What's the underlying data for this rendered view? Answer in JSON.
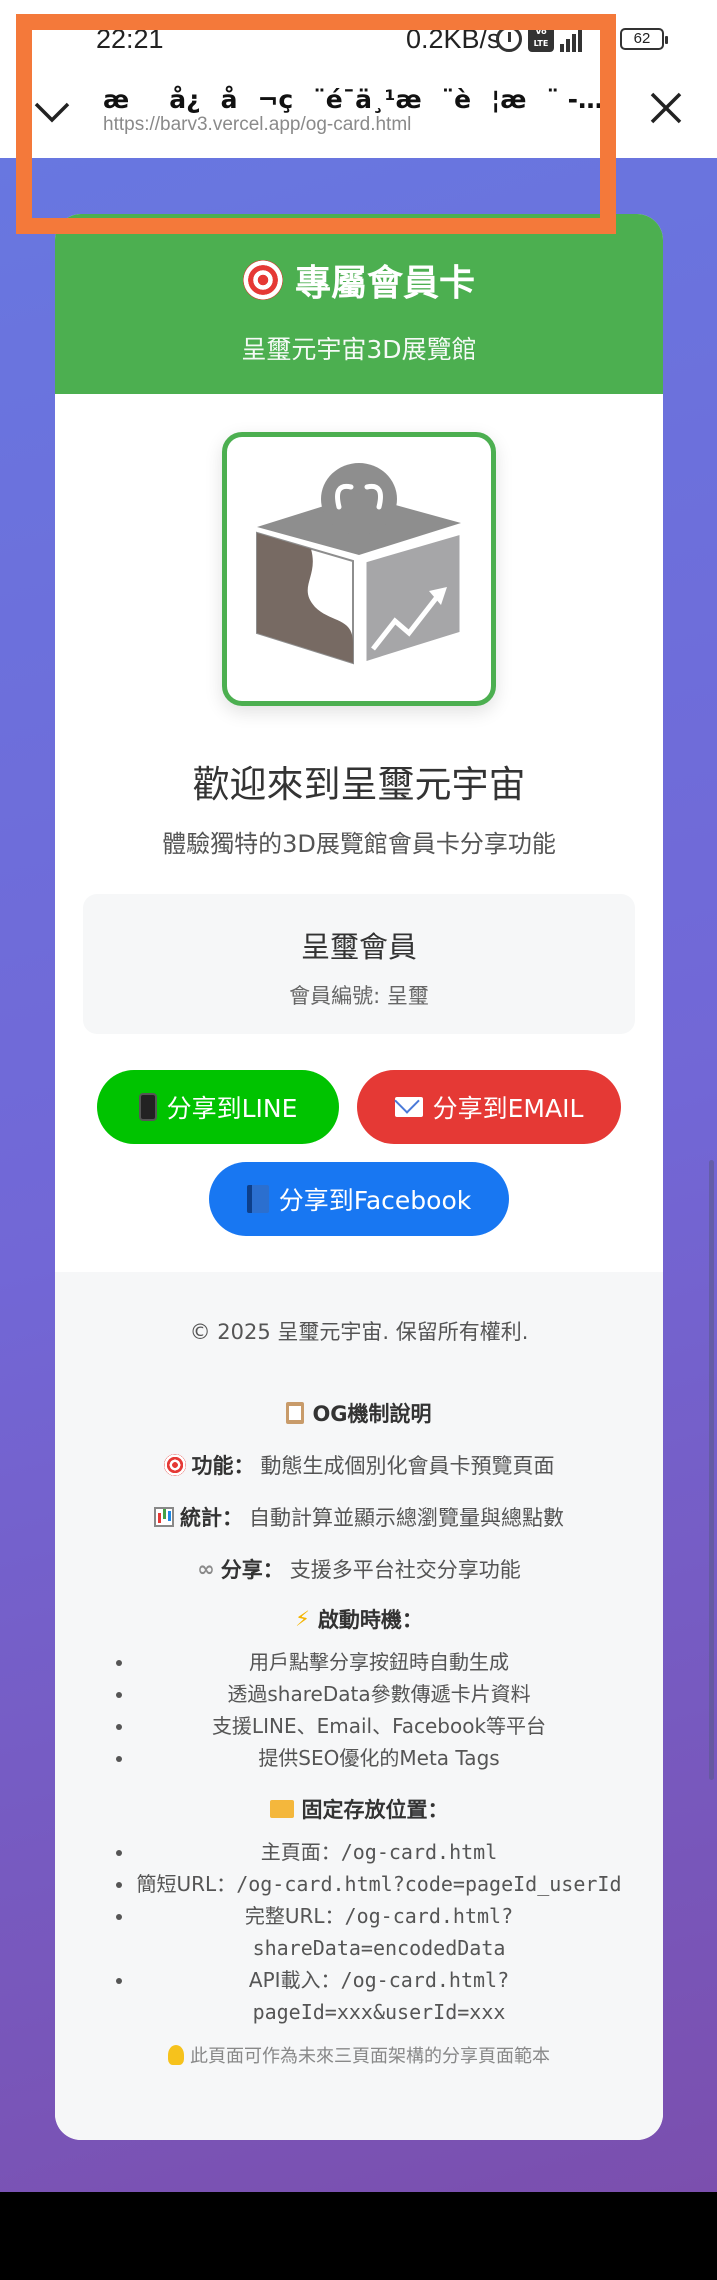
{
  "status_bar": {
    "time": "22:21",
    "network_speed": "0.2KB/s",
    "volte_label": "Vo LTE",
    "signal_label": "5G",
    "battery": "62"
  },
  "browser": {
    "page_title": "æå¿å¬ç¨é¯ä¸¹æ¨è¦æ¨ - 呈璽元...",
    "url": "https://barv3.vercel.app/og-card.html",
    "colors": {
      "highlight": "#f4793a"
    }
  },
  "card": {
    "header_title": "專屬會員卡",
    "header_subtitle": "呈璽元宇宙3D展覽館",
    "welcome": "歡迎來到呈璽元宇宙",
    "welcome_sub": "體驗獨特的3D展覽館會員卡分享功能",
    "member_name": "呈璽會員",
    "member_id": "會員編號: 呈璽",
    "buttons": {
      "line": "分享到LINE",
      "email": "分享到EMAIL",
      "facebook": "分享到Facebook"
    },
    "colors": {
      "header": "#4caf50",
      "line": "#00c300",
      "email": "#e53935",
      "facebook": "#1877f2"
    }
  },
  "footer": {
    "copyright": "© 2025 呈璽元宇宙. 保留所有權利.",
    "og_title": "OG機制說明",
    "features": [
      {
        "label": "功能：",
        "text": "動態生成個別化會員卡預覽頁面"
      },
      {
        "label": "統計：",
        "text": "自動計算並顯示總瀏覽量與總點數"
      },
      {
        "label": "分享：",
        "text": "支援多平台社交分享功能"
      }
    ],
    "trigger_title": "啟動時機：",
    "triggers": [
      "用戶點擊分享按鈕時自動生成",
      "透過shareData參數傳遞卡片資料",
      "支援LINE、Email、Facebook等平台",
      "提供SEO優化的Meta Tags"
    ],
    "storage_title": "固定存放位置：",
    "storage": [
      {
        "label": "主頁面：",
        "code": "/og-card.html"
      },
      {
        "label": "簡短URL：",
        "code": "/og-card.html?code=pageId_userId"
      },
      {
        "label": "完整URL：",
        "code": "/og-card.html?shareData=encodedData"
      },
      {
        "label": "API載入：",
        "code": "/og-card.html?pageId=xxx&userId=xxx"
      }
    ],
    "note": "此頁面可作為未來三頁面架構的分享頁面範本"
  }
}
